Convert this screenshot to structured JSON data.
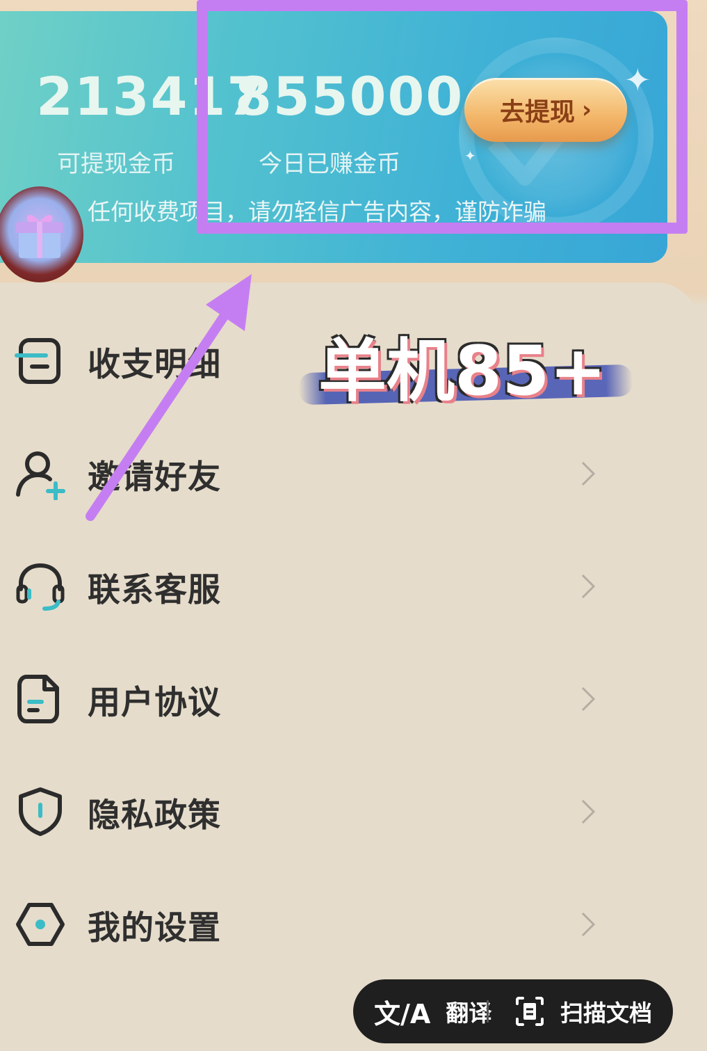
{
  "wallet": {
    "withdrawable_coins": "213417",
    "withdrawable_label": "可提现金币",
    "today_coins": "855000",
    "today_label": "今日已赚金币",
    "withdraw_button": "去提现",
    "notice": "任何收费项目，请勿轻信广告内容，谨防诈骗"
  },
  "overlay": {
    "promo_text": "单机85+"
  },
  "menu": {
    "items": [
      {
        "label": "收支明细",
        "icon": "ledger-icon"
      },
      {
        "label": "邀请好友",
        "icon": "add-user-icon"
      },
      {
        "label": "联系客服",
        "icon": "headset-icon"
      },
      {
        "label": "用户协议",
        "icon": "document-icon"
      },
      {
        "label": "隐私政策",
        "icon": "shield-icon"
      },
      {
        "label": "我的设置",
        "icon": "settings-icon"
      }
    ]
  },
  "float_bar": {
    "translate_label": "翻译",
    "scan_label": "扫描文档"
  },
  "colors": {
    "card_accent": "#3fb1d6",
    "highlight": "#c57ef2",
    "icon_teal": "#3bbcc6"
  }
}
